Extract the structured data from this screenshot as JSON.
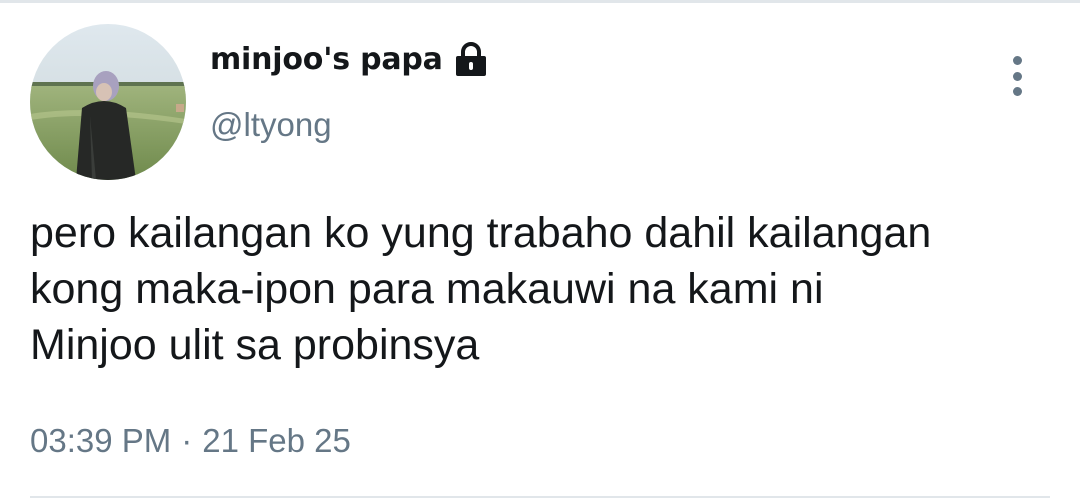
{
  "tweet": {
    "author": {
      "display_name": "minjoo's papa",
      "handle": "@ltyong",
      "avatar_icon": "avatar-photo",
      "protected_icon": "lock-icon"
    },
    "text_lines": [
      "pero kailangan ko yung trabaho dahil kailangan",
      "kong maka-ipon para makauwi na kami ni",
      "Minjoo ulit sa probinsya"
    ],
    "time": "03:39 PM",
    "separator": "·",
    "date": "21 Feb 25",
    "more_icon": "more-vertical-icon"
  },
  "colors": {
    "primary_text": "#14171a",
    "secondary_text": "#657786",
    "divider": "#e1e6ea",
    "background": "#ffffff"
  }
}
